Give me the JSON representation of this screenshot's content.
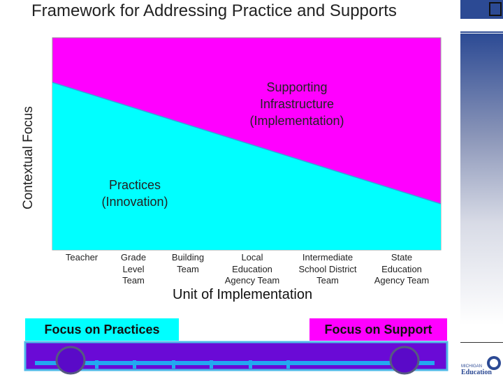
{
  "title": "Framework for Addressing Practice and Supports",
  "y_axis_label": "Contextual Focus",
  "x_axis_label": "Unit of Implementation",
  "regions": {
    "support": "Supporting\nInfrastructure\n(Implementation)",
    "practices": "Practices\n(Innovation)"
  },
  "units": [
    "Teacher",
    "Grade\nLevel\nTeam",
    "Building\nTeam",
    "Local\nEducation\nAgency Team",
    "Intermediate\nSchool District\nTeam",
    "State\nEducation\nAgency Team"
  ],
  "focus": {
    "practices": "Focus on Practices",
    "support": "Focus on Support"
  },
  "logo": {
    "text": "MICHIGAN Education"
  },
  "colors": {
    "magenta": "#ff00ff",
    "cyan": "#00ffff",
    "bus": "#6a0ad6",
    "bus_stripe": "#22a8f0",
    "sidebar": "#2c4a94"
  }
}
